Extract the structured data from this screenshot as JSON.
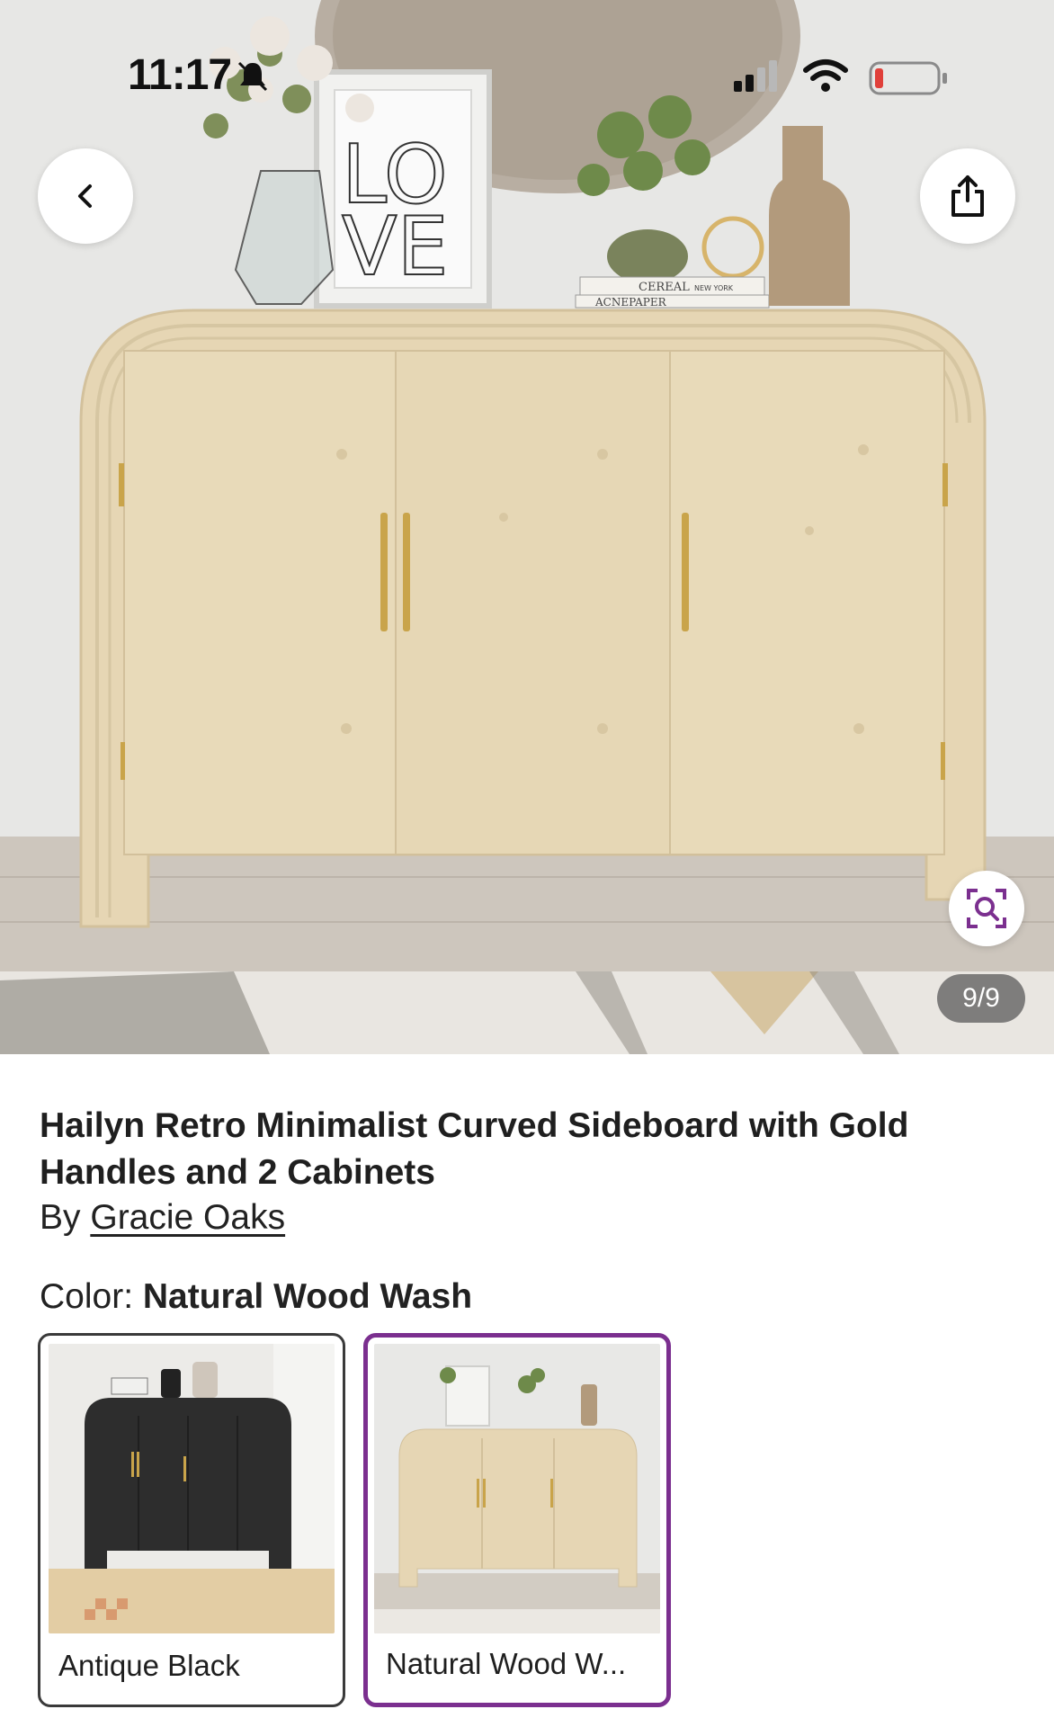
{
  "status_bar": {
    "time": "11:17"
  },
  "gallery": {
    "counter": "9/9",
    "current": 9,
    "total": 9
  },
  "product": {
    "title": "Hailyn Retro Minimalist Curved Sideboard with Gold Handles and 2 Cabinets",
    "brand_prefix": "By",
    "brand": "Gracie Oaks"
  },
  "options": {
    "color_label": "Color:",
    "selected_color": "Natural Wood Wash",
    "swatches": [
      {
        "label": "Antique Black",
        "selected": false
      },
      {
        "label": "Natural Wood W...",
        "selected": true
      }
    ]
  },
  "colors": {
    "accent": "#7b2f8f",
    "cabinet": "#e6d6b4",
    "handle": "#c9a44a"
  },
  "icons": [
    "bell-slash-icon",
    "signal-icon",
    "wifi-icon",
    "battery-icon",
    "back-chevron-icon",
    "share-icon",
    "visual-search-icon"
  ],
  "hero_text": {
    "frame_text_1": "LO",
    "frame_text_2": "VE",
    "book_1": "CEREAL",
    "book_1_sub": "NEW YORK",
    "book_2": "ACNEPAPER"
  }
}
